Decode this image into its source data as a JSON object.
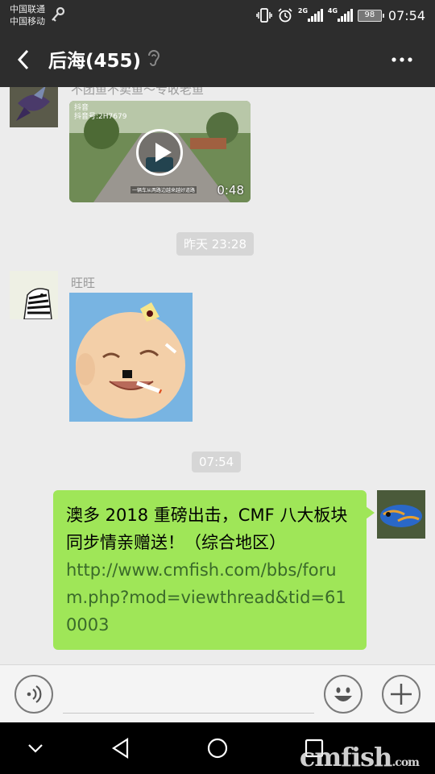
{
  "status_bar": {
    "carrier_1": "中国联通",
    "carrier_2": "中国移动",
    "net_1": "2G",
    "net_2": "4G",
    "battery": "98",
    "time": "07:54"
  },
  "nav": {
    "title": "后海(455)",
    "back_icon": "chevron-left-icon",
    "ear_icon": "ear-icon",
    "more_icon": "more-dots-icon"
  },
  "messages": {
    "video": {
      "sender_name": "不团鱼不卖鱼～专收老鱼",
      "duration": "0:48",
      "badge_line1": "抖音",
      "badge_line2": "抖音号:2H7679",
      "caption": "一辆车从两路边越来越好道路"
    },
    "timestamp_1": "昨天 23:28",
    "sticker": {
      "sender_name": "旺旺"
    },
    "timestamp_2": "07:54",
    "outgoing": {
      "text": "澳多 2018 重磅出击，CMF 八大板块同步情亲赠送！（综合地区）",
      "link": "http://www.cmfish.com/bbs/forum.php?mod=viewthread&tid=610003"
    }
  },
  "input_bar": {
    "placeholder": "",
    "voice_icon": "voice-icon",
    "emoji_icon": "emoji-icon",
    "plus_icon": "plus-icon"
  },
  "system_nav": {
    "watermark_main": "cmfish",
    "watermark_suffix": ".com"
  },
  "colors": {
    "header_bg": "#2d2d2d",
    "chat_bg": "#ececec",
    "bubble_green": "#9fe658",
    "timestamp_chip": "#d6d6d6"
  }
}
